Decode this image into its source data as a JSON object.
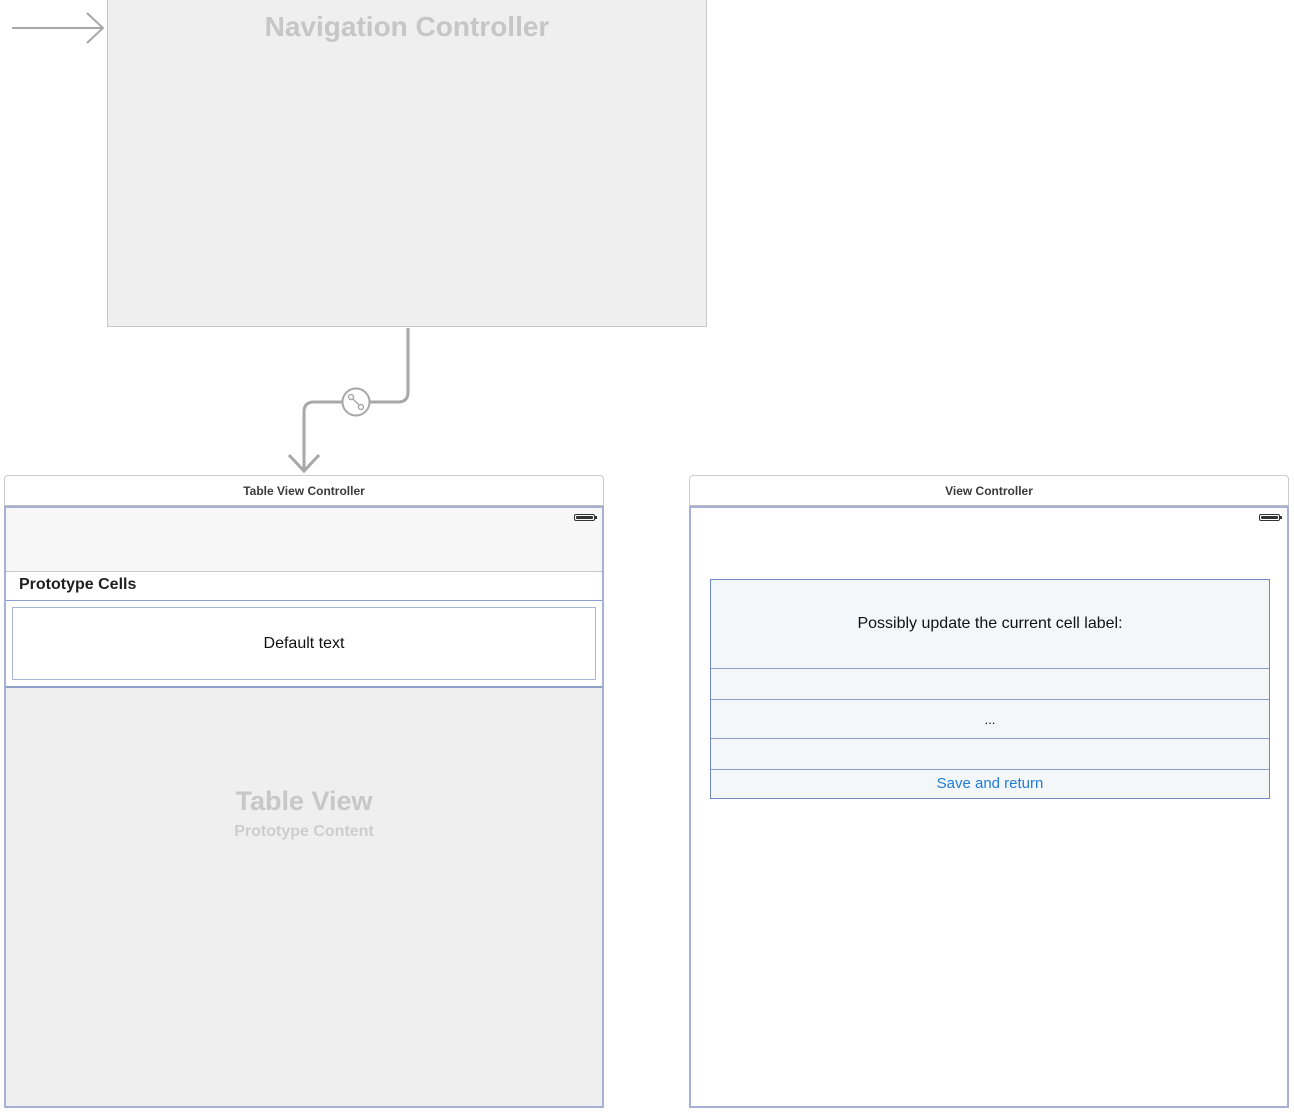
{
  "navigation_controller": {
    "title": "Navigation Controller"
  },
  "segue": {
    "icon": "segue-icon"
  },
  "table_view_controller": {
    "header": "Table View Controller",
    "prototype_cells_label": "Prototype Cells",
    "cell_text": "Default text",
    "table_view_title": "Table View",
    "table_view_subtitle": "Prototype Content"
  },
  "view_controller": {
    "header": "View Controller",
    "prompt_label": "Possibly update the current cell label:",
    "ellipsis": "...",
    "save_button_label": "Save and return"
  },
  "colors": {
    "canvas": "#ffffff",
    "scene_fill": "#efefef",
    "selection_border": "#a7b1d8",
    "link_blue": "#1f7cd6",
    "connector": "#a8a8a8"
  }
}
